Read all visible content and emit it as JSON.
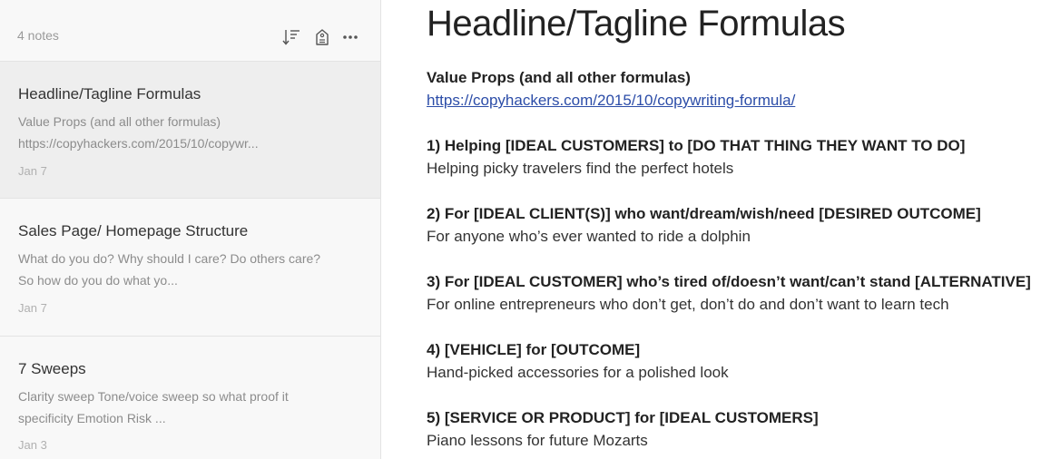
{
  "sidebar": {
    "note_count": "4 notes",
    "icons": [
      "sort-icon",
      "tag-icon",
      "more-icon"
    ],
    "notes": [
      {
        "title": "Headline/Tagline Formulas",
        "snippet_line1": "Value Props (and all other formulas)",
        "snippet_line2": "https://copyhackers.com/2015/10/copywr...",
        "date": "Jan 7",
        "selected": true
      },
      {
        "title": "Sales Page/ Homepage Structure",
        "snippet_line1": "What do you do? Why should I care? Do others care?",
        "snippet_line2": "So how do you do what yo...",
        "date": "Jan 7",
        "selected": false
      },
      {
        "title": "7 Sweeps",
        "snippet_line1": "Clarity sweep Tone/voice sweep so what proof it",
        "snippet_line2": "specificity  Emotion  Risk ...",
        "date": "Jan 3",
        "selected": false
      }
    ]
  },
  "editor": {
    "title": "Headline/Tagline Formulas",
    "intro_heading": "Value Props (and all other formulas)",
    "intro_link": "https://copyhackers.com/2015/10/copywriting-formula/",
    "formulas": [
      {
        "heading": "1) Helping [IDEAL CUSTOMERS] to [DO THAT THING THEY WANT TO DO]",
        "example": "Helping picky travelers find the perfect hotels"
      },
      {
        "heading": "2) For [IDEAL CLIENT(S)] who want/dream/wish/need [DESIRED OUTCOME]",
        "example": "For anyone who’s ever wanted to ride a dolphin"
      },
      {
        "heading": "3) For [IDEAL CUSTOMER] who’s tired of/doesn’t want/can’t stand [ALTERNATIVE]",
        "example": "For online entrepreneurs who don’t get, don’t do and don’t want to learn tech"
      },
      {
        "heading": "4) [VEHICLE] for [OUTCOME]",
        "example": "Hand-picked accessories for a polished look"
      },
      {
        "heading": "5) [SERVICE OR PRODUCT] for [IDEAL CUSTOMERS]",
        "example": "Piano lessons for future Mozarts"
      }
    ]
  },
  "colors": {
    "sidebar_bg": "#f8f8f8",
    "selected_bg": "#eeeeee",
    "link": "#2c4da8"
  }
}
